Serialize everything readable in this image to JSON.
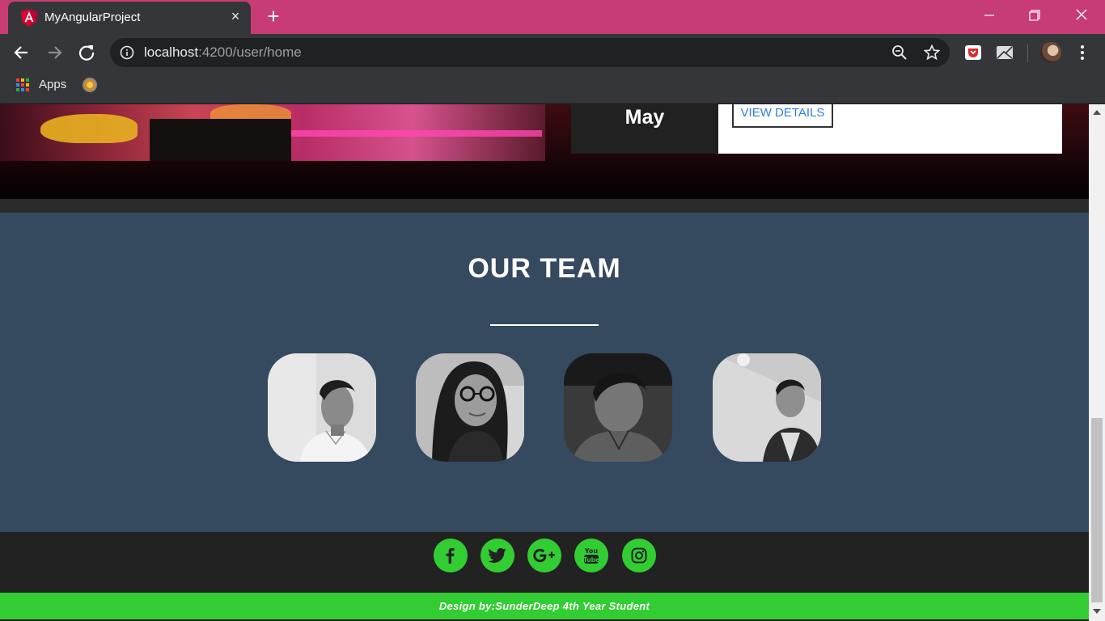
{
  "browser": {
    "tab": {
      "title": "MyAngularProject"
    },
    "address": {
      "host": "localhost",
      "rest": ":4200/user/home"
    },
    "bookmarks": [
      {
        "label": "Apps"
      }
    ]
  },
  "page": {
    "event": {
      "month": "May",
      "cta_label": "VIEW DETAILS"
    },
    "team": {
      "title": "OUR TEAM",
      "members": [
        "member-1",
        "member-2",
        "member-3",
        "member-4"
      ]
    },
    "social": [
      "facebook",
      "twitter",
      "google-plus",
      "youtube",
      "instagram"
    ],
    "footer": {
      "credit": "Design by:SunderDeep 4th Year Student"
    }
  },
  "colors": {
    "tab_strip": "#c83c76",
    "team_bg": "#35495f",
    "accent_green": "#32cd32",
    "link_blue": "#2d7de0"
  }
}
